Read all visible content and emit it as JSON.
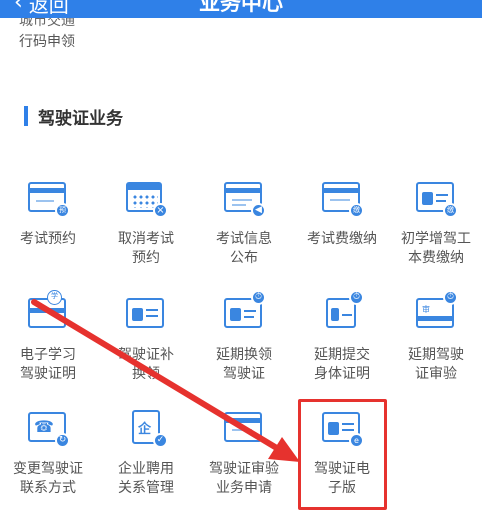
{
  "header": {
    "back_label": "返回",
    "title": "业务中心"
  },
  "previous_section_tail": {
    "line1": "城市交通",
    "line2": "行码申领"
  },
  "section": {
    "title": "驾驶证业务"
  },
  "services": [
    {
      "line1": "考试预约",
      "line2": "",
      "icon": "exam-booking-icon"
    },
    {
      "line1": "取消考试",
      "line2": "预约",
      "icon": "cancel-exam-icon"
    },
    {
      "line1": "考试信息",
      "line2": "公布",
      "icon": "exam-info-icon"
    },
    {
      "line1": "考试费缴纳",
      "line2": "",
      "icon": "exam-fee-icon"
    },
    {
      "line1": "初学增驾工",
      "line2": "本费缴纳",
      "icon": "beginner-fee-icon"
    },
    {
      "line1": "电子学习",
      "line2": "驾驶证明",
      "icon": "study-certificate-icon"
    },
    {
      "line1": "驾驶证补",
      "line2": "换领",
      "icon": "license-replace-icon"
    },
    {
      "line1": "延期换领",
      "line2": "驾驶证",
      "icon": "delay-renew-icon"
    },
    {
      "line1": "延期提交",
      "line2": "身体证明",
      "icon": "delay-health-icon"
    },
    {
      "line1": "延期驾驶",
      "line2": "证审验",
      "icon": "delay-review-icon"
    },
    {
      "line1": "变更驾驶证",
      "line2": "联系方式",
      "icon": "change-contact-icon"
    },
    {
      "line1": "企业聘用",
      "line2": "关系管理",
      "icon": "enterprise-icon"
    },
    {
      "line1": "驾驶证审验",
      "line2": "业务申请",
      "icon": "license-review-icon"
    },
    {
      "line1": "驾驶证电",
      "line2": "子版",
      "icon": "e-license-icon"
    }
  ],
  "badges": {
    "exam_booking": "预",
    "exam_fee": "缴",
    "beginner_fee": "缴",
    "study_card": "学",
    "delay_review_card": "审"
  },
  "colors": {
    "header": "#2f80e8",
    "icon": "#3a86e0",
    "annotation": "#e6322e"
  }
}
